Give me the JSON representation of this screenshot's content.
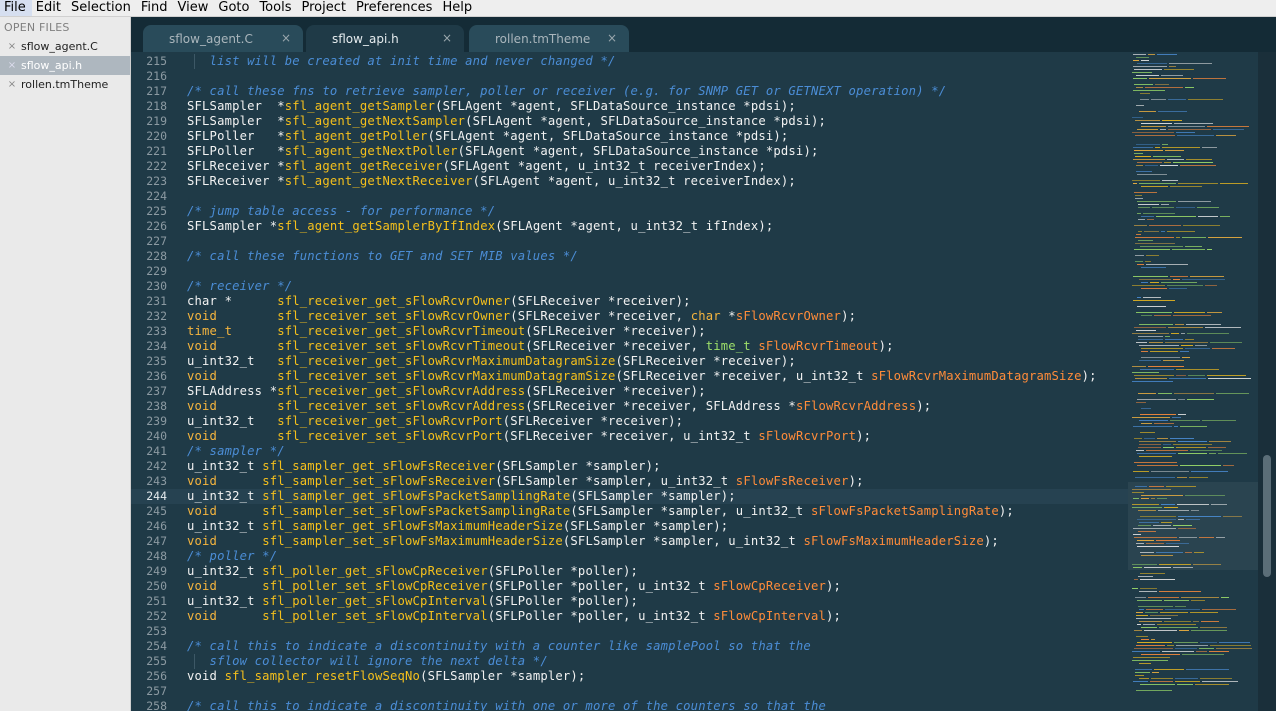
{
  "menu": [
    "File",
    "Edit",
    "Selection",
    "Find",
    "View",
    "Goto",
    "Tools",
    "Project",
    "Preferences",
    "Help"
  ],
  "sidebar": {
    "header": "OPEN FILES",
    "close_glyph": "×",
    "files": [
      {
        "name": "sflow_agent.C",
        "selected": false
      },
      {
        "name": "sflow_api.h",
        "selected": true
      },
      {
        "name": "rollen.tmTheme",
        "selected": false
      }
    ]
  },
  "tabs": [
    {
      "name": "sflow_agent.C",
      "active": false
    },
    {
      "name": "sflow_api.h",
      "active": true
    },
    {
      "name": "rollen.tmTheme",
      "active": false
    }
  ],
  "tab_close_glyph": "×",
  "editor": {
    "current_line": 244,
    "colors": {
      "background": "#1f3a47",
      "comment": "#4b8dd6",
      "function": "#f5c01c",
      "type": "#f6b53e",
      "param": "#ff8c3a",
      "text": "#f2f2f2"
    },
    "lines": [
      {
        "n": 215,
        "guide": true,
        "t": [
          [
            "   list will be created at init time and never changed */",
            "c"
          ]
        ]
      },
      {
        "n": 216,
        "t": []
      },
      {
        "n": 217,
        "t": [
          [
            "/* call these fns to retrieve sampler, poller or receiver (e.g. for SNMP GET or GETNEXT operation) */",
            "c"
          ]
        ]
      },
      {
        "n": 218,
        "t": [
          [
            "SFLSampler  *",
            ""
          ],
          [
            "sfl_agent_getSampler",
            "f"
          ],
          [
            "(SFLAgent *agent, SFLDataSource_instance *pdsi);",
            ""
          ]
        ]
      },
      {
        "n": 219,
        "t": [
          [
            "SFLSampler  *",
            ""
          ],
          [
            "sfl_agent_getNextSampler",
            "f"
          ],
          [
            "(SFLAgent *agent, SFLDataSource_instance *pdsi);",
            ""
          ]
        ]
      },
      {
        "n": 220,
        "t": [
          [
            "SFLPoller   *",
            ""
          ],
          [
            "sfl_agent_getPoller",
            "f"
          ],
          [
            "(SFLAgent *agent, SFLDataSource_instance *pdsi);",
            ""
          ]
        ]
      },
      {
        "n": 221,
        "t": [
          [
            "SFLPoller   *",
            ""
          ],
          [
            "sfl_agent_getNextPoller",
            "f"
          ],
          [
            "(SFLAgent *agent, SFLDataSource_instance *pdsi);",
            ""
          ]
        ]
      },
      {
        "n": 222,
        "t": [
          [
            "SFLReceiver *",
            ""
          ],
          [
            "sfl_agent_getReceiver",
            "f"
          ],
          [
            "(SFLAgent *agent, u_int32_t receiverIndex);",
            ""
          ]
        ]
      },
      {
        "n": 223,
        "t": [
          [
            "SFLReceiver *",
            ""
          ],
          [
            "sfl_agent_getNextReceiver",
            "f"
          ],
          [
            "(SFLAgent *agent, u_int32_t receiverIndex);",
            ""
          ]
        ]
      },
      {
        "n": 224,
        "t": []
      },
      {
        "n": 225,
        "t": [
          [
            "/* jump table access - for performance */",
            "c"
          ]
        ]
      },
      {
        "n": 226,
        "t": [
          [
            "SFLSampler *",
            ""
          ],
          [
            "sfl_agent_getSamplerByIfIndex",
            "f"
          ],
          [
            "(SFLAgent *agent, u_int32_t ifIndex);",
            ""
          ]
        ]
      },
      {
        "n": 227,
        "t": []
      },
      {
        "n": 228,
        "t": [
          [
            "/* call these functions to GET and SET MIB values */",
            "c"
          ]
        ]
      },
      {
        "n": 229,
        "t": []
      },
      {
        "n": 230,
        "t": [
          [
            "/* receiver */",
            "c"
          ]
        ]
      },
      {
        "n": 231,
        "t": [
          [
            "char *",
            ""
          ],
          [
            "      ",
            ""
          ],
          [
            "sfl_receiver_get_sFlowRcvrOwner",
            "f"
          ],
          [
            "(SFLReceiver *receiver);",
            ""
          ]
        ]
      },
      {
        "n": 232,
        "t": [
          [
            "void",
            "k"
          ],
          [
            "        ",
            ""
          ],
          [
            "sfl_receiver_set_sFlowRcvrOwner",
            "f"
          ],
          [
            "(SFLReceiver *receiver, ",
            ""
          ],
          [
            "char",
            "k"
          ],
          [
            " *",
            ""
          ],
          [
            "sFlowRcvrOwner",
            "p"
          ],
          [
            ");",
            ""
          ]
        ]
      },
      {
        "n": 233,
        "t": [
          [
            "time_t",
            "k"
          ],
          [
            "      ",
            ""
          ],
          [
            "sfl_receiver_get_sFlowRcvrTimeout",
            "f"
          ],
          [
            "(SFLReceiver *receiver);",
            ""
          ]
        ]
      },
      {
        "n": 234,
        "t": [
          [
            "void",
            "k"
          ],
          [
            "        ",
            ""
          ],
          [
            "sfl_receiver_set_sFlowRcvrTimeout",
            "f"
          ],
          [
            "(SFLReceiver *receiver, ",
            ""
          ],
          [
            "time_t",
            "g"
          ],
          [
            " ",
            ""
          ],
          [
            "sFlowRcvrTimeout",
            "p"
          ],
          [
            ");",
            ""
          ]
        ]
      },
      {
        "n": 235,
        "t": [
          [
            "u_int32_t   ",
            ""
          ],
          [
            "sfl_receiver_get_sFlowRcvrMaximumDatagramSize",
            "f"
          ],
          [
            "(SFLReceiver *receiver);",
            ""
          ]
        ]
      },
      {
        "n": 236,
        "t": [
          [
            "void",
            "k"
          ],
          [
            "        ",
            ""
          ],
          [
            "sfl_receiver_set_sFlowRcvrMaximumDatagramSize",
            "f"
          ],
          [
            "(SFLReceiver *receiver, u_int32_t ",
            ""
          ],
          [
            "sFlowRcvrMaximumDatagramSize",
            "p"
          ],
          [
            ");",
            ""
          ]
        ]
      },
      {
        "n": 237,
        "t": [
          [
            "SFLAddress *",
            ""
          ],
          [
            "sfl_receiver_get_sFlowRcvrAddress",
            "f"
          ],
          [
            "(SFLReceiver *receiver);",
            ""
          ]
        ]
      },
      {
        "n": 238,
        "t": [
          [
            "void",
            "k"
          ],
          [
            "        ",
            ""
          ],
          [
            "sfl_receiver_set_sFlowRcvrAddress",
            "f"
          ],
          [
            "(SFLReceiver *receiver, SFLAddress *",
            ""
          ],
          [
            "sFlowRcvrAddress",
            "p"
          ],
          [
            ");",
            ""
          ]
        ]
      },
      {
        "n": 239,
        "t": [
          [
            "u_int32_t   ",
            ""
          ],
          [
            "sfl_receiver_get_sFlowRcvrPort",
            "f"
          ],
          [
            "(SFLReceiver *receiver);",
            ""
          ]
        ]
      },
      {
        "n": 240,
        "t": [
          [
            "void",
            "k"
          ],
          [
            "        ",
            ""
          ],
          [
            "sfl_receiver_set_sFlowRcvrPort",
            "f"
          ],
          [
            "(SFLReceiver *receiver, u_int32_t ",
            ""
          ],
          [
            "sFlowRcvrPort",
            "p"
          ],
          [
            ");",
            ""
          ]
        ]
      },
      {
        "n": 241,
        "t": [
          [
            "/* sampler */",
            "c"
          ]
        ]
      },
      {
        "n": 242,
        "t": [
          [
            "u_int32_t ",
            ""
          ],
          [
            "sfl_sampler_get_sFlowFsReceiver",
            "f"
          ],
          [
            "(SFLSampler *sampler);",
            ""
          ]
        ]
      },
      {
        "n": 243,
        "t": [
          [
            "void",
            "k"
          ],
          [
            "      ",
            ""
          ],
          [
            "sfl_sampler_set_sFlowFsReceiver",
            "f"
          ],
          [
            "(SFLSampler *sampler, u_int32_t ",
            ""
          ],
          [
            "sFlowFsReceiver",
            "p"
          ],
          [
            ");",
            ""
          ]
        ]
      },
      {
        "n": 244,
        "t": [
          [
            "u_int32_t ",
            ""
          ],
          [
            "sfl_sampler_get_sFlowFsPacketSamplingRate",
            "f"
          ],
          [
            "(SFLSampler *sampler);",
            ""
          ]
        ]
      },
      {
        "n": 245,
        "t": [
          [
            "void",
            "k"
          ],
          [
            "      ",
            ""
          ],
          [
            "sfl_sampler_set_sFlowFsPacketSamplingRate",
            "f"
          ],
          [
            "(SFLSampler *sampler, u_int32_t ",
            ""
          ],
          [
            "sFlowFsPacketSamplingRate",
            "p"
          ],
          [
            ");",
            ""
          ]
        ]
      },
      {
        "n": 246,
        "t": [
          [
            "u_int32_t ",
            ""
          ],
          [
            "sfl_sampler_get_sFlowFsMaximumHeaderSize",
            "f"
          ],
          [
            "(SFLSampler *sampler);",
            ""
          ]
        ]
      },
      {
        "n": 247,
        "t": [
          [
            "void",
            "k"
          ],
          [
            "      ",
            ""
          ],
          [
            "sfl_sampler_set_sFlowFsMaximumHeaderSize",
            "f"
          ],
          [
            "(SFLSampler *sampler, u_int32_t ",
            ""
          ],
          [
            "sFlowFsMaximumHeaderSize",
            "p"
          ],
          [
            ");",
            ""
          ]
        ]
      },
      {
        "n": 248,
        "t": [
          [
            "/* poller */",
            "c"
          ]
        ]
      },
      {
        "n": 249,
        "t": [
          [
            "u_int32_t ",
            ""
          ],
          [
            "sfl_poller_get_sFlowCpReceiver",
            "f"
          ],
          [
            "(SFLPoller *poller);",
            ""
          ]
        ]
      },
      {
        "n": 250,
        "t": [
          [
            "void",
            "k"
          ],
          [
            "      ",
            ""
          ],
          [
            "sfl_poller_set_sFlowCpReceiver",
            "f"
          ],
          [
            "(SFLPoller *poller, u_int32_t ",
            ""
          ],
          [
            "sFlowCpReceiver",
            "p"
          ],
          [
            ");",
            ""
          ]
        ]
      },
      {
        "n": 251,
        "t": [
          [
            "u_int32_t ",
            ""
          ],
          [
            "sfl_poller_get_sFlowCpInterval",
            "f"
          ],
          [
            "(SFLPoller *poller);",
            ""
          ]
        ]
      },
      {
        "n": 252,
        "t": [
          [
            "void",
            "k"
          ],
          [
            "      ",
            ""
          ],
          [
            "sfl_poller_set_sFlowCpInterval",
            "f"
          ],
          [
            "(SFLPoller *poller, u_int32_t ",
            ""
          ],
          [
            "sFlowCpInterval",
            "p"
          ],
          [
            ");",
            ""
          ]
        ]
      },
      {
        "n": 253,
        "t": []
      },
      {
        "n": 254,
        "t": [
          [
            "/* call this to indicate a discontinuity with a counter like samplePool so that the",
            "c"
          ]
        ]
      },
      {
        "n": 255,
        "guide": true,
        "t": [
          [
            "   sflow collector will ignore the next delta */",
            "c"
          ]
        ]
      },
      {
        "n": 256,
        "t": [
          [
            "void ",
            ""
          ],
          [
            "sfl_sampler_resetFlowSeqNo",
            "f"
          ],
          [
            "(SFLSampler *sampler);",
            ""
          ]
        ]
      },
      {
        "n": 257,
        "t": []
      },
      {
        "n": 258,
        "t": [
          [
            "/* call this to indicate a discontinuity with one or more of the counters so that the",
            "c"
          ]
        ]
      }
    ]
  }
}
